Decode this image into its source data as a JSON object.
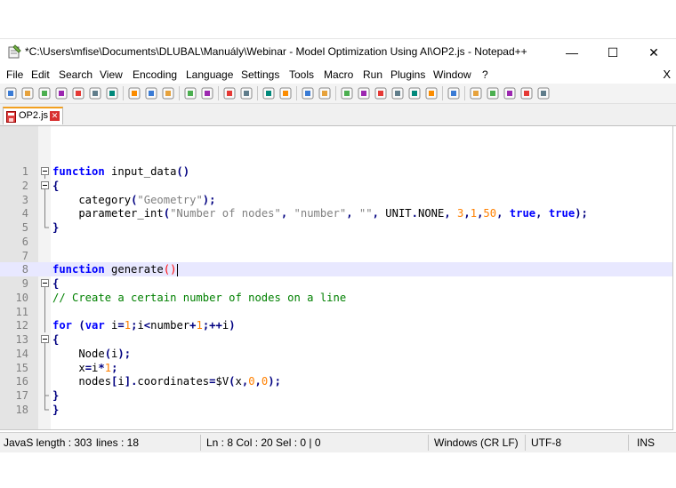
{
  "window": {
    "title": "*C:\\Users\\mfise\\Documents\\DLUBAL\\Manuály\\Webinar - Model Optimization Using AI\\OP2.js - Notepad++",
    "minimize": "—",
    "maximize": "☐",
    "close": "✕"
  },
  "menu": {
    "items": [
      "File",
      "Edit",
      "Search",
      "View",
      "Encoding",
      "Language",
      "Settings",
      "Tools",
      "Macro",
      "Run",
      "Plugins",
      "Window",
      "?"
    ],
    "close": "X"
  },
  "toolbar": {
    "icons": [
      "new-file-icon",
      "open-file-icon",
      "save-icon",
      "save-all-icon",
      "close-icon",
      "close-all-icon",
      "print-icon",
      "cut-icon",
      "copy-icon",
      "paste-icon",
      "undo-icon",
      "redo-icon",
      "find-icon",
      "replace-icon",
      "zoom-in-icon",
      "zoom-out-icon",
      "sync-vertical-icon",
      "sync-horizontal-icon",
      "word-wrap-icon",
      "show-all-chars-icon",
      "indent-guide-icon",
      "doc-map-icon",
      "function-list-icon",
      "folder-workspace-icon",
      "monitor-icon",
      "record-macro-icon",
      "stop-record-icon",
      "playback-macro-icon",
      "run-macro-multiple-icon",
      "save-macro-icon"
    ]
  },
  "tab": {
    "label": "OP2.js",
    "close": "✕"
  },
  "editor": {
    "current_line": 8,
    "lines": [
      {
        "n": "1",
        "fold": "minus",
        "code": [
          {
            "t": "function",
            "c": "kw"
          },
          {
            "t": " input_data",
            "c": "fn"
          },
          {
            "t": "()",
            "c": "op"
          }
        ]
      },
      {
        "n": "2",
        "fold": "box",
        "code": [
          {
            "t": "{",
            "c": "op"
          }
        ]
      },
      {
        "n": "3",
        "fold": "line",
        "code": [
          {
            "t": "    category",
            "c": "tx"
          },
          {
            "t": "(",
            "c": "op"
          },
          {
            "t": "\"Geometry\"",
            "c": "str"
          },
          {
            "t": ");",
            "c": "op"
          }
        ]
      },
      {
        "n": "4",
        "fold": "line",
        "code": [
          {
            "t": "    parameter_int",
            "c": "tx"
          },
          {
            "t": "(",
            "c": "op"
          },
          {
            "t": "\"Number of nodes\"",
            "c": "str"
          },
          {
            "t": ", ",
            "c": "op"
          },
          {
            "t": "\"number\"",
            "c": "str"
          },
          {
            "t": ", ",
            "c": "op"
          },
          {
            "t": "\"\"",
            "c": "str"
          },
          {
            "t": ", ",
            "c": "op"
          },
          {
            "t": "UNIT",
            "c": "tx"
          },
          {
            "t": ".",
            "c": "op"
          },
          {
            "t": "NONE",
            "c": "tx"
          },
          {
            "t": ", ",
            "c": "op"
          },
          {
            "t": "3",
            "c": "num"
          },
          {
            "t": ",",
            "c": "op"
          },
          {
            "t": "1",
            "c": "num"
          },
          {
            "t": ",",
            "c": "op"
          },
          {
            "t": "50",
            "c": "num"
          },
          {
            "t": ", ",
            "c": "op"
          },
          {
            "t": "true",
            "c": "kw"
          },
          {
            "t": ", ",
            "c": "op"
          },
          {
            "t": "true",
            "c": "kw"
          },
          {
            "t": ");",
            "c": "op"
          }
        ]
      },
      {
        "n": "5",
        "fold": "end",
        "code": [
          {
            "t": "}",
            "c": "op"
          }
        ]
      },
      {
        "n": "6",
        "fold": "none",
        "code": []
      },
      {
        "n": "7",
        "fold": "none",
        "code": []
      },
      {
        "n": "8",
        "fold": "none",
        "code": [
          {
            "t": "function",
            "c": "kw"
          },
          {
            "t": " generate",
            "c": "fn"
          },
          {
            "t": "()",
            "c": "brm"
          }
        ],
        "caret": true
      },
      {
        "n": "9",
        "fold": "box",
        "code": [
          {
            "t": "{",
            "c": "op"
          }
        ]
      },
      {
        "n": "10",
        "fold": "line",
        "code": [
          {
            "t": "// Create a certain number of nodes on a line",
            "c": "cm"
          }
        ]
      },
      {
        "n": "11",
        "fold": "line",
        "code": []
      },
      {
        "n": "12",
        "fold": "line",
        "code": [
          {
            "t": "for",
            "c": "kw"
          },
          {
            "t": " (",
            "c": "op"
          },
          {
            "t": "var",
            "c": "kw"
          },
          {
            "t": " i",
            "c": "tx"
          },
          {
            "t": "=",
            "c": "op"
          },
          {
            "t": "1",
            "c": "num"
          },
          {
            "t": ";",
            "c": "op"
          },
          {
            "t": "i",
            "c": "tx"
          },
          {
            "t": "<",
            "c": "op"
          },
          {
            "t": "number",
            "c": "tx"
          },
          {
            "t": "+",
            "c": "op"
          },
          {
            "t": "1",
            "c": "num"
          },
          {
            "t": ";++",
            "c": "op"
          },
          {
            "t": "i",
            "c": "tx"
          },
          {
            "t": ")",
            "c": "op"
          }
        ]
      },
      {
        "n": "13",
        "fold": "box",
        "code": [
          {
            "t": "{",
            "c": "op"
          }
        ]
      },
      {
        "n": "14",
        "fold": "line",
        "code": [
          {
            "t": "    Node",
            "c": "tx"
          },
          {
            "t": "(",
            "c": "op"
          },
          {
            "t": "i",
            "c": "tx"
          },
          {
            "t": ");",
            "c": "op"
          }
        ]
      },
      {
        "n": "15",
        "fold": "line",
        "code": [
          {
            "t": "    x",
            "c": "tx"
          },
          {
            "t": "=",
            "c": "op"
          },
          {
            "t": "i",
            "c": "tx"
          },
          {
            "t": "*",
            "c": "op"
          },
          {
            "t": "1",
            "c": "num"
          },
          {
            "t": ";",
            "c": "op"
          }
        ]
      },
      {
        "n": "16",
        "fold": "line",
        "code": [
          {
            "t": "    nodes",
            "c": "tx"
          },
          {
            "t": "[",
            "c": "op"
          },
          {
            "t": "i",
            "c": "tx"
          },
          {
            "t": "].",
            "c": "op"
          },
          {
            "t": "coordinates",
            "c": "tx"
          },
          {
            "t": "=",
            "c": "op"
          },
          {
            "t": "$V",
            "c": "tx"
          },
          {
            "t": "(",
            "c": "op"
          },
          {
            "t": "x",
            "c": "tx"
          },
          {
            "t": ",",
            "c": "op"
          },
          {
            "t": "0",
            "c": "num"
          },
          {
            "t": ",",
            "c": "op"
          },
          {
            "t": "0",
            "c": "num"
          },
          {
            "t": ");",
            "c": "op"
          }
        ]
      },
      {
        "n": "17",
        "fold": "end-mid",
        "code": [
          {
            "t": "}",
            "c": "op"
          }
        ]
      },
      {
        "n": "18",
        "fold": "end",
        "code": [
          {
            "t": "}",
            "c": "op"
          }
        ]
      }
    ]
  },
  "status": {
    "length": "JavaS length : 303",
    "lines": "lines : 18",
    "position": "Ln : 8   Col : 20   Sel : 0 | 0",
    "eol": "Windows (CR LF)",
    "encoding": "UTF-8",
    "mode": "INS"
  },
  "colors": {
    "keyword": "#0000ff",
    "string": "#808080",
    "number": "#ff8000",
    "comment": "#008000",
    "operator": "#000080",
    "current_line": "#e8e8ff",
    "tab_accent": "#f2a020"
  }
}
